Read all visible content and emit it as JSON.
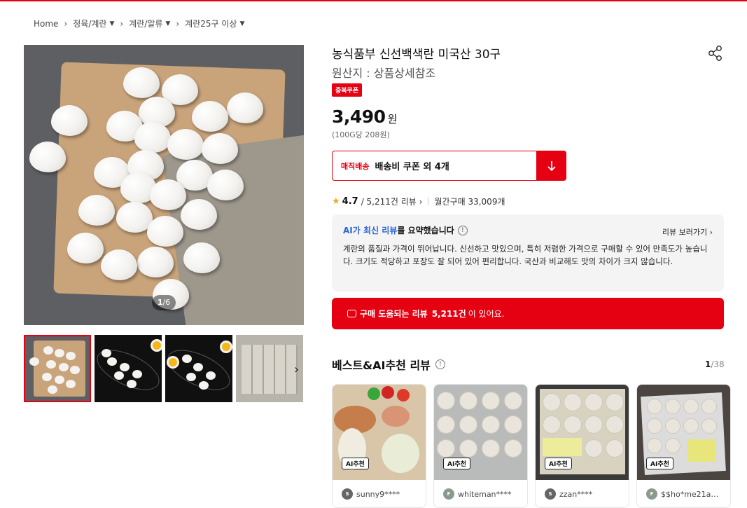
{
  "breadcrumb": {
    "items": [
      "Home",
      "정육/계란",
      "계란/알류",
      "계란25구 이상"
    ]
  },
  "gallery": {
    "counter_current": "1",
    "counter_total": "/6"
  },
  "product": {
    "title": "농식품부 신선백색란 미국산 30구",
    "origin": "원산지 : 상품상세참조",
    "coupon_badge": "중복쿠폰",
    "price": "3,490",
    "price_unit": "원",
    "unit_price": "(100G당 208원)"
  },
  "delivery": {
    "label": "매직배송",
    "text": "배송비 쿠폰 외 4개"
  },
  "rating": {
    "score": "4.7",
    "reviews": "/ 5,211건 리뷰",
    "monthly": "월간구매 33,009개"
  },
  "ai_summary": {
    "accent": "AI가 최신 리뷰",
    "head_rest": "를 요약했습니다",
    "more": "리뷰 보러가기",
    "body": "계란의 품질과 가격이 뛰어납니다. 신선하고 맛있으며, 특히 저렴한 가격으로 구매할 수 있어 만족도가 높습니다. 크기도 적당하고 포장도 잘 되어 있어 편리합니다. 국산과 비교해도 맛의 차이가 크지 않습니다."
  },
  "review_banner": {
    "prefix": "구매 도움되는 리뷰",
    "count": "5,211건",
    "suffix": "이 있어요."
  },
  "best_reviews": {
    "title": "베스트&AI추천 리뷰",
    "page_current": "1",
    "page_total": "/38",
    "cards": [
      {
        "tag": "AI추천",
        "user": "sunny9****",
        "avatar": "S"
      },
      {
        "tag": "AI추천",
        "user": "whiteman****",
        "avatar": "F"
      },
      {
        "tag": "AI추천",
        "user": "zzan****",
        "avatar": "S"
      },
      {
        "tag": "AI추천",
        "user": "$$ho*me21a…",
        "avatar": "F"
      }
    ]
  },
  "colors": {
    "accent": "#e50012",
    "ai_blue": "#2e64d8",
    "star": "#f5a623"
  },
  "icons": [
    "share-icon",
    "chevron-right-icon",
    "arrow-down-icon",
    "star-icon",
    "info-icon",
    "chat-icon"
  ]
}
